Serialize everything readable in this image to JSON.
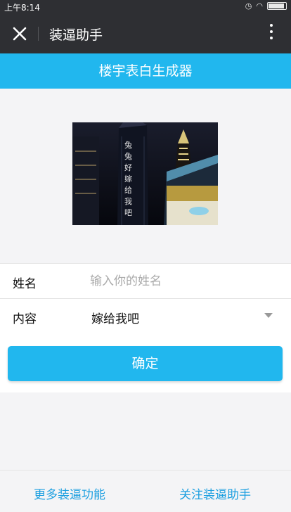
{
  "status_bar": {
    "time": "上午8:14"
  },
  "top_bar": {
    "title": "装逼助手"
  },
  "app_bar": {
    "title": "楼宇表白生成器"
  },
  "preview_image": {
    "overlay_text": "兔兔好嫁给我吧"
  },
  "form": {
    "name": {
      "label": "姓名",
      "placeholder": "输入你的姓名",
      "value": ""
    },
    "content": {
      "label": "内容",
      "value": "嫁给我吧"
    }
  },
  "confirm_button": {
    "label": "确定"
  },
  "footer": {
    "more_link": "更多装逼功能",
    "follow_link": "关注装逼助手"
  },
  "colors": {
    "accent": "#21b7ee",
    "topbar": "#2e2f33",
    "link": "#1c9fe0"
  },
  "icons": [
    "close-icon",
    "more-vertical-icon",
    "dropdown-caret-icon",
    "wifi-icon",
    "alarm-icon",
    "battery-icon"
  ]
}
